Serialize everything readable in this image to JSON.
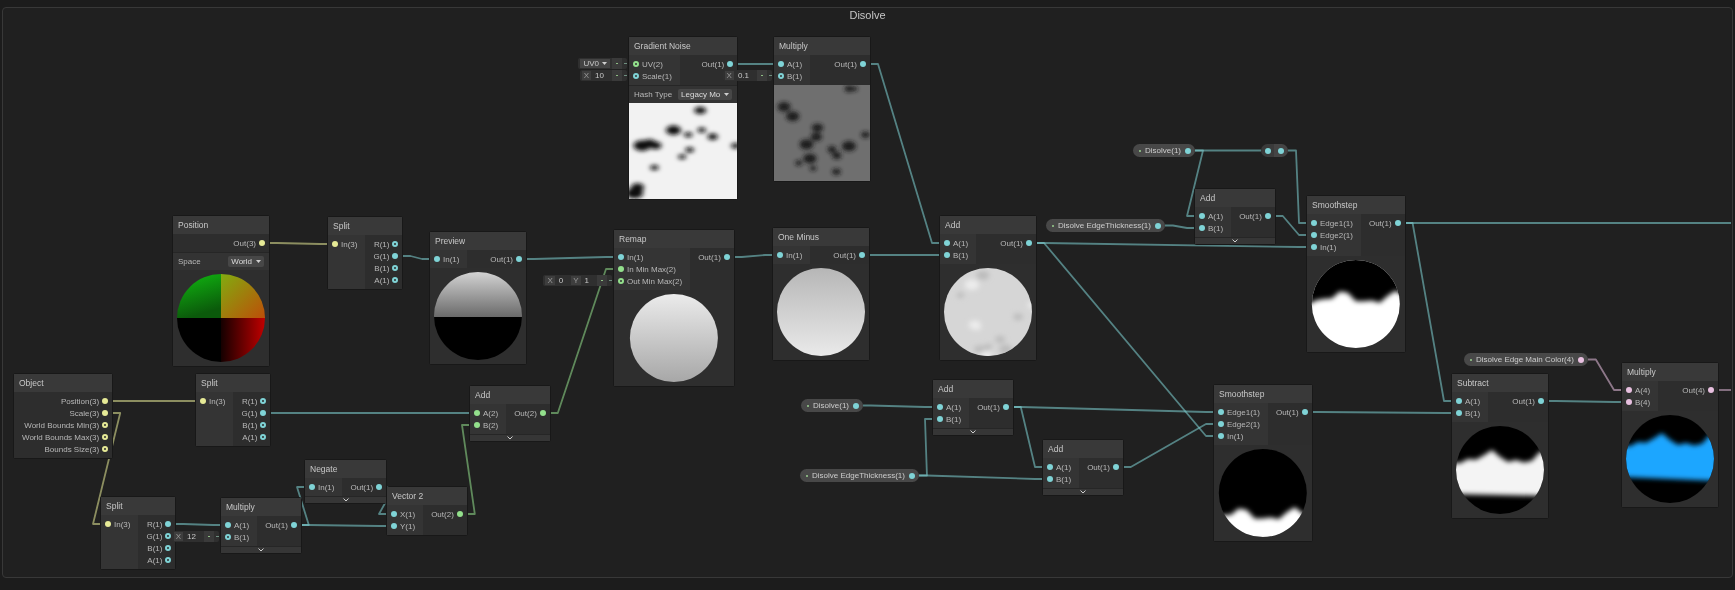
{
  "group": {
    "title": "Disolve"
  },
  "nodes": [
    {
      "kind": "node",
      "title": "Gradient Noise",
      "inputs": [
        {
          "label": "UV(2)",
          "color": "#93e08c",
          "connected": false,
          "dropdown": "UV0"
        },
        {
          "label": "Scale(1)",
          "color": "#7fd3d6",
          "connected": false,
          "field": [
            {
              "axis": "X",
              "value": "10"
            }
          ]
        }
      ],
      "outputs": [
        {
          "label": "Out(1)",
          "color": "#7fd3d6",
          "connected": true
        }
      ],
      "settings": [
        {
          "label": "Hash Type",
          "value": "Legacy Mo"
        }
      ],
      "preview": {
        "kind": "picture"
      }
    },
    {
      "kind": "node",
      "title": "Multiply",
      "inputs": [
        {
          "label": "A(1)",
          "color": "#7fd3d6",
          "connected": true
        },
        {
          "label": "B(1)",
          "color": "#7fd3d6",
          "connected": false,
          "field": [
            {
              "axis": "X",
              "value": "0.1"
            }
          ]
        }
      ],
      "outputs": [
        {
          "label": "Out(1)",
          "color": "#7fd3d6",
          "connected": true
        }
      ],
      "preview": {
        "kind": "picture"
      }
    },
    {
      "kind": "node",
      "title": "Position",
      "outputs": [
        {
          "label": "Out(3)",
          "color": "#e6ea96",
          "connected": true
        }
      ],
      "settings": [
        {
          "label": "Space",
          "value": "World"
        }
      ],
      "preview": {
        "kind": "picture"
      }
    },
    {
      "kind": "node",
      "title": "Split",
      "inputs": [
        {
          "label": "In(3)",
          "color": "#e6ea96",
          "connected": true
        }
      ],
      "outputs": [
        {
          "label": "R(1)",
          "color": "#7fd3d6",
          "connected": false
        },
        {
          "label": "G(1)",
          "color": "#7fd3d6",
          "connected": true
        },
        {
          "label": "B(1)",
          "color": "#7fd3d6",
          "connected": false
        },
        {
          "label": "A(1)",
          "color": "#7fd3d6",
          "connected": false
        }
      ]
    },
    {
      "kind": "node",
      "title": "Preview",
      "inputs": [
        {
          "label": "In(1)",
          "color": "#7fd3d6",
          "connected": true
        }
      ],
      "outputs": [
        {
          "label": "Out(1)",
          "color": "#7fd3d6",
          "connected": true
        }
      ],
      "preview": {
        "kind": "picture"
      }
    },
    {
      "kind": "node",
      "title": "Remap",
      "inputs": [
        {
          "label": "In(1)",
          "color": "#7fd3d6",
          "connected": true
        },
        {
          "label": "In Min Max(2)",
          "color": "#93e08c",
          "connected": true
        },
        {
          "label": "Out Min Max(2)",
          "color": "#93e08c",
          "connected": false,
          "field": [
            {
              "axis": "X",
              "value": "0"
            },
            {
              "axis": "Y",
              "value": "1"
            }
          ]
        }
      ],
      "outputs": [
        {
          "label": "Out(1)",
          "color": "#7fd3d6",
          "connected": true
        }
      ],
      "preview": {
        "kind": "picture"
      }
    },
    {
      "kind": "node",
      "title": "One Minus",
      "inputs": [
        {
          "label": "In(1)",
          "color": "#7fd3d6",
          "connected": true
        }
      ],
      "outputs": [
        {
          "label": "Out(1)",
          "color": "#7fd3d6",
          "connected": true
        }
      ],
      "preview": {
        "kind": "picture"
      }
    },
    {
      "kind": "node",
      "title": "Add",
      "inputs": [
        {
          "label": "A(1)",
          "color": "#7fd3d6",
          "connected": true
        },
        {
          "label": "B(1)",
          "color": "#7fd3d6",
          "connected": true
        }
      ],
      "outputs": [
        {
          "label": "Out(1)",
          "color": "#7fd3d6",
          "connected": true
        }
      ],
      "preview": {
        "kind": "picture"
      }
    },
    {
      "kind": "property",
      "label": "Disolve EdgeThickness(1)",
      "exposed": true,
      "output": {
        "color": "#7fd3d6",
        "connected": true
      }
    },
    {
      "kind": "property",
      "label": "Disolve(1)",
      "exposed": true,
      "output": {
        "color": "#7fd3d6",
        "connected": true
      }
    },
    {
      "kind": "reroute",
      "input": {
        "color": "#7fd3d6",
        "connected": true
      },
      "output": {
        "color": "#7fd3d6",
        "connected": true
      }
    },
    {
      "kind": "node",
      "title": "Add",
      "inputs": [
        {
          "label": "A(1)",
          "color": "#7fd3d6",
          "connected": true
        },
        {
          "label": "B(1)",
          "color": "#7fd3d6",
          "connected": true
        }
      ],
      "outputs": [
        {
          "label": "Out(1)",
          "color": "#7fd3d6",
          "connected": true
        }
      ],
      "expand_button": true
    },
    {
      "kind": "node",
      "title": "Smoothstep",
      "inputs": [
        {
          "label": "Edge1(1)",
          "color": "#7fd3d6",
          "connected": true
        },
        {
          "label": "Edge2(1)",
          "color": "#7fd3d6",
          "connected": true
        },
        {
          "label": "In(1)",
          "color": "#7fd3d6",
          "connected": true
        }
      ],
      "outputs": [
        {
          "label": "Out(1)",
          "color": "#7fd3d6",
          "connected": true
        }
      ],
      "preview": {
        "kind": "picture"
      }
    },
    {
      "kind": "node",
      "title": "Object",
      "outputs": [
        {
          "label": "Position(3)",
          "color": "#e6ea96",
          "connected": true
        },
        {
          "label": "Scale(3)",
          "color": "#e6ea96",
          "connected": true
        },
        {
          "label": "World Bounds Min(3)",
          "color": "#e6ea96",
          "connected": false
        },
        {
          "label": "World Bounds Max(3)",
          "color": "#e6ea96",
          "connected": false
        },
        {
          "label": "Bounds Size(3)",
          "color": "#e6ea96",
          "connected": false
        }
      ]
    },
    {
      "kind": "node",
      "title": "Split",
      "inputs": [
        {
          "label": "In(3)",
          "color": "#e6ea96",
          "connected": true
        }
      ],
      "outputs": [
        {
          "label": "R(1)",
          "color": "#7fd3d6",
          "connected": false
        },
        {
          "label": "G(1)",
          "color": "#7fd3d6",
          "connected": true
        },
        {
          "label": "B(1)",
          "color": "#7fd3d6",
          "connected": false
        },
        {
          "label": "A(1)",
          "color": "#7fd3d6",
          "connected": false
        }
      ]
    },
    {
      "kind": "node",
      "title": "Add",
      "inputs": [
        {
          "label": "A(2)",
          "color": "#93e08c",
          "connected": true
        },
        {
          "label": "B(2)",
          "color": "#93e08c",
          "connected": true
        }
      ],
      "outputs": [
        {
          "label": "Out(2)",
          "color": "#93e08c",
          "connected": true
        }
      ],
      "expand_button": true
    },
    {
      "kind": "property",
      "label": "Disolve(1)",
      "exposed": true,
      "output": {
        "color": "#7fd3d6",
        "connected": true
      }
    },
    {
      "kind": "node",
      "title": "Add",
      "inputs": [
        {
          "label": "A(1)",
          "color": "#7fd3d6",
          "connected": true
        },
        {
          "label": "B(1)",
          "color": "#7fd3d6",
          "connected": true
        }
      ],
      "outputs": [
        {
          "label": "Out(1)",
          "color": "#7fd3d6",
          "connected": true
        }
      ],
      "expand_button": true
    },
    {
      "kind": "property",
      "label": "Disolve EdgeThickness(1)",
      "exposed": true,
      "output": {
        "color": "#7fd3d6",
        "connected": true
      }
    },
    {
      "kind": "node",
      "title": "Add",
      "inputs": [
        {
          "label": "A(1)",
          "color": "#7fd3d6",
          "connected": true
        },
        {
          "label": "B(1)",
          "color": "#7fd3d6",
          "connected": true
        }
      ],
      "outputs": [
        {
          "label": "Out(1)",
          "color": "#7fd3d6",
          "connected": true
        }
      ],
      "expand_button": true
    },
    {
      "kind": "node",
      "title": "Smoothstep",
      "inputs": [
        {
          "label": "Edge1(1)",
          "color": "#7fd3d6",
          "connected": true
        },
        {
          "label": "Edge2(1)",
          "color": "#7fd3d6",
          "connected": true
        },
        {
          "label": "In(1)",
          "color": "#7fd3d6",
          "connected": true
        }
      ],
      "outputs": [
        {
          "label": "Out(1)",
          "color": "#7fd3d6",
          "connected": true
        }
      ],
      "preview": {
        "kind": "picture"
      }
    },
    {
      "kind": "property",
      "label": "Disolve Edge Main Color(4)",
      "exposed": true,
      "output": {
        "color": "#e8c0e0",
        "connected": true
      }
    },
    {
      "kind": "node",
      "title": "Subtract",
      "inputs": [
        {
          "label": "A(1)",
          "color": "#7fd3d6",
          "connected": true
        },
        {
          "label": "B(1)",
          "color": "#7fd3d6",
          "connected": true
        }
      ],
      "outputs": [
        {
          "label": "Out(1)",
          "color": "#7fd3d6",
          "connected": true
        }
      ],
      "preview": {
        "kind": "picture"
      }
    },
    {
      "kind": "node",
      "title": "Multiply",
      "inputs": [
        {
          "label": "A(4)",
          "color": "#e8c0e0",
          "connected": true
        },
        {
          "label": "B(4)",
          "color": "#e8c0e0",
          "connected": true
        }
      ],
      "outputs": [
        {
          "label": "Out(4)",
          "color": "#e8c0e0",
          "connected": true
        }
      ],
      "preview": {
        "kind": "picture"
      }
    },
    {
      "kind": "node",
      "title": "Negate",
      "inputs": [
        {
          "label": "In(1)",
          "color": "#7fd3d6",
          "connected": true
        }
      ],
      "outputs": [
        {
          "label": "Out(1)",
          "color": "#7fd3d6",
          "connected": true
        }
      ],
      "expand_button": true
    },
    {
      "kind": "node",
      "title": "Vector 2",
      "inputs": [
        {
          "label": "X(1)",
          "color": "#7fd3d6",
          "connected": true
        },
        {
          "label": "Y(1)",
          "color": "#7fd3d6",
          "connected": true
        }
      ],
      "outputs": [
        {
          "label": "Out(2)",
          "color": "#93e08c",
          "connected": true
        }
      ]
    },
    {
      "kind": "node",
      "title": "Split",
      "inputs": [
        {
          "label": "In(3)",
          "color": "#e6ea96",
          "connected": true
        }
      ],
      "outputs": [
        {
          "label": "R(1)",
          "color": "#7fd3d6",
          "connected": true
        },
        {
          "label": "G(1)",
          "color": "#7fd3d6",
          "connected": false
        },
        {
          "label": "B(1)",
          "color": "#7fd3d6",
          "connected": false
        },
        {
          "label": "A(1)",
          "color": "#7fd3d6",
          "connected": false
        }
      ]
    },
    {
      "kind": "node",
      "title": "Multiply",
      "inputs": [
        {
          "label": "A(1)",
          "color": "#7fd3d6",
          "connected": true
        },
        {
          "label": "B(1)",
          "color": "#7fd3d6",
          "connected": false,
          "field": [
            {
              "axis": "X",
              "value": "12"
            }
          ]
        }
      ],
      "outputs": [
        {
          "label": "Out(1)",
          "color": "#7fd3d6",
          "connected": true
        }
      ],
      "expand_button": true
    }
  ]
}
